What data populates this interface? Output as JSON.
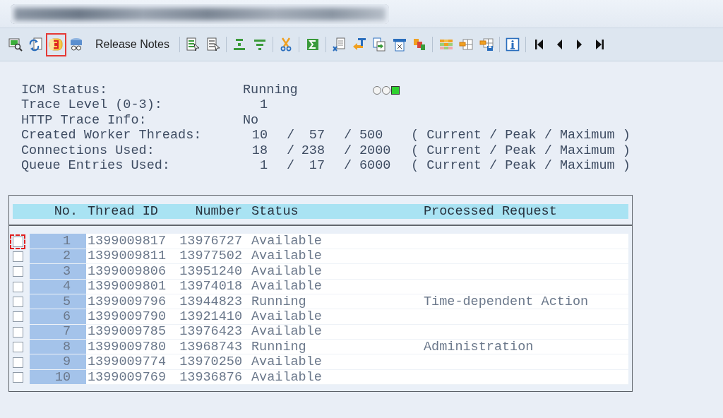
{
  "title_bar": {
    "redacted": true
  },
  "toolbar": {
    "items": [
      {
        "kind": "icon",
        "highlighted": false
      },
      {
        "kind": "icon",
        "highlighted": false
      },
      {
        "kind": "icon",
        "highlighted": true
      },
      {
        "kind": "icon",
        "highlighted": false
      },
      {
        "kind": "text",
        "label": "Release Notes",
        "highlighted": false
      },
      {
        "kind": "separator"
      },
      {
        "kind": "icon",
        "highlighted": false
      },
      {
        "kind": "icon",
        "highlighted": false
      },
      {
        "kind": "separator"
      },
      {
        "kind": "icon",
        "highlighted": false
      },
      {
        "kind": "icon",
        "highlighted": false
      },
      {
        "kind": "separator"
      },
      {
        "kind": "icon",
        "highlighted": false
      },
      {
        "kind": "separator"
      },
      {
        "kind": "icon",
        "highlighted": false
      },
      {
        "kind": "separator"
      },
      {
        "kind": "icon",
        "highlighted": false
      },
      {
        "kind": "icon",
        "highlighted": false
      },
      {
        "kind": "icon",
        "highlighted": false
      },
      {
        "kind": "icon",
        "highlighted": false
      },
      {
        "kind": "icon",
        "highlighted": false
      },
      {
        "kind": "separator"
      },
      {
        "kind": "icon",
        "highlighted": false
      },
      {
        "kind": "icon",
        "highlighted": false
      },
      {
        "kind": "icon",
        "highlighted": false
      },
      {
        "kind": "separator"
      },
      {
        "kind": "icon",
        "highlighted": false
      },
      {
        "kind": "separator"
      },
      {
        "kind": "icon",
        "highlighted": false
      },
      {
        "kind": "icon",
        "highlighted": false
      },
      {
        "kind": "icon",
        "highlighted": false
      },
      {
        "kind": "icon",
        "highlighted": false
      }
    ]
  },
  "status": [
    {
      "kind": "text",
      "label": "ICM Status:",
      "value": "Running",
      "lights": [
        {
          "on": false
        },
        {
          "on": false
        },
        {
          "on": true
        }
      ]
    },
    {
      "kind": "number",
      "label": "Trace Level (0-3):",
      "value": "1"
    },
    {
      "kind": "text",
      "label": "HTTP Trace Info:",
      "value": "No"
    },
    {
      "kind": "usage",
      "label": "Created Worker Threads:",
      "current": "10",
      "peak": "57",
      "maximum": "500",
      "separators": [
        "/",
        "/"
      ],
      "legend": "( Current / Peak / Maximum )"
    },
    {
      "kind": "usage",
      "label": "Connections Used:",
      "current": "18",
      "peak": "238",
      "maximum": "2000",
      "separators": [
        "/",
        "/"
      ],
      "legend": "( Current / Peak / Maximum )"
    },
    {
      "kind": "usage",
      "label": "Queue Entries Used:",
      "current": "1",
      "peak": "17",
      "maximum": "6000",
      "separators": [
        "/",
        "/"
      ],
      "legend": "( Current / Peak / Maximum )"
    }
  ],
  "table": {
    "columns": [
      "No.",
      "Thread ID",
      "Number",
      "Status",
      "Processed Request"
    ],
    "rows": [
      {
        "checked": false,
        "focused": true,
        "no": "1",
        "thread_id": "1399009817",
        "number": "13976727",
        "status": "Available"
      },
      {
        "checked": false,
        "focused": false,
        "no": "2",
        "thread_id": "1399009811",
        "number": "13977502",
        "status": "Available"
      },
      {
        "checked": false,
        "focused": false,
        "no": "3",
        "thread_id": "1399009806",
        "number": "13951240",
        "status": "Available"
      },
      {
        "checked": false,
        "focused": false,
        "no": "4",
        "thread_id": "1399009801",
        "number": "13974018",
        "status": "Available"
      },
      {
        "checked": false,
        "focused": false,
        "no": "5",
        "thread_id": "1399009796",
        "number": "13944823",
        "status": "Running",
        "request": "Time-dependent Action"
      },
      {
        "checked": false,
        "focused": false,
        "no": "6",
        "thread_id": "1399009790",
        "number": "13921410",
        "status": "Available"
      },
      {
        "checked": false,
        "focused": false,
        "no": "7",
        "thread_id": "1399009785",
        "number": "13976423",
        "status": "Available"
      },
      {
        "checked": false,
        "focused": false,
        "no": "8",
        "thread_id": "1399009780",
        "number": "13968743",
        "status": "Running",
        "request": "Administration"
      },
      {
        "checked": false,
        "focused": false,
        "no": "9",
        "thread_id": "1399009774",
        "number": "13970250",
        "status": "Available"
      },
      {
        "checked": false,
        "focused": false,
        "no": "10",
        "thread_id": "1399009769",
        "number": "13936876",
        "status": "Available"
      }
    ]
  }
}
